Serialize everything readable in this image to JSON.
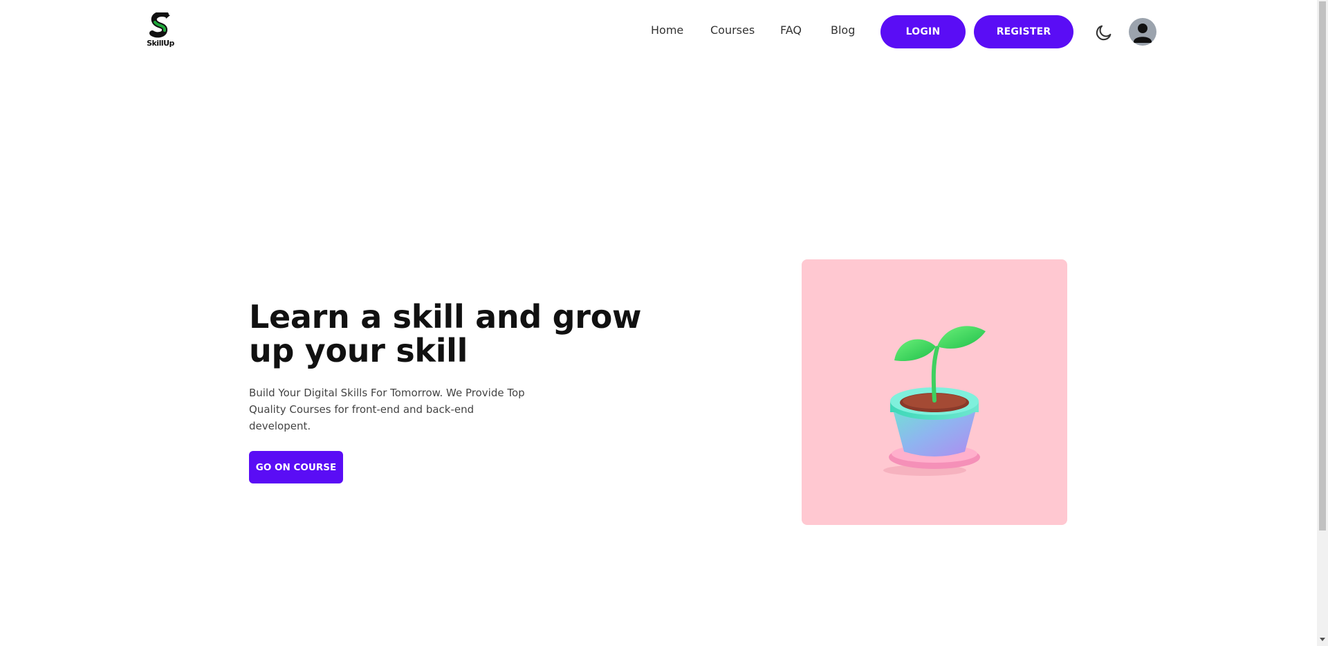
{
  "brand": {
    "name": "SkillUp",
    "accent_color": "#5a0df5",
    "logo_green": "#1fa83a"
  },
  "nav": {
    "links": [
      {
        "label": "Home"
      },
      {
        "label": "Courses"
      },
      {
        "label": "FAQ"
      },
      {
        "label": "Blog"
      }
    ],
    "login_label": "LOGIN",
    "register_label": "REGISTER",
    "theme_icon": "moon-icon",
    "avatar_icon": "user-icon"
  },
  "hero": {
    "title": "Learn a skill and grow up your skill",
    "subtitle": "Build Your Digital Skills For Tomorrow. We Provide Top Quality Courses for front-end and back-end developent.",
    "cta_label": "GO ON COURSE",
    "image_background": "#ffc8d1",
    "image_subject": "sprout-in-pot-illustration"
  }
}
